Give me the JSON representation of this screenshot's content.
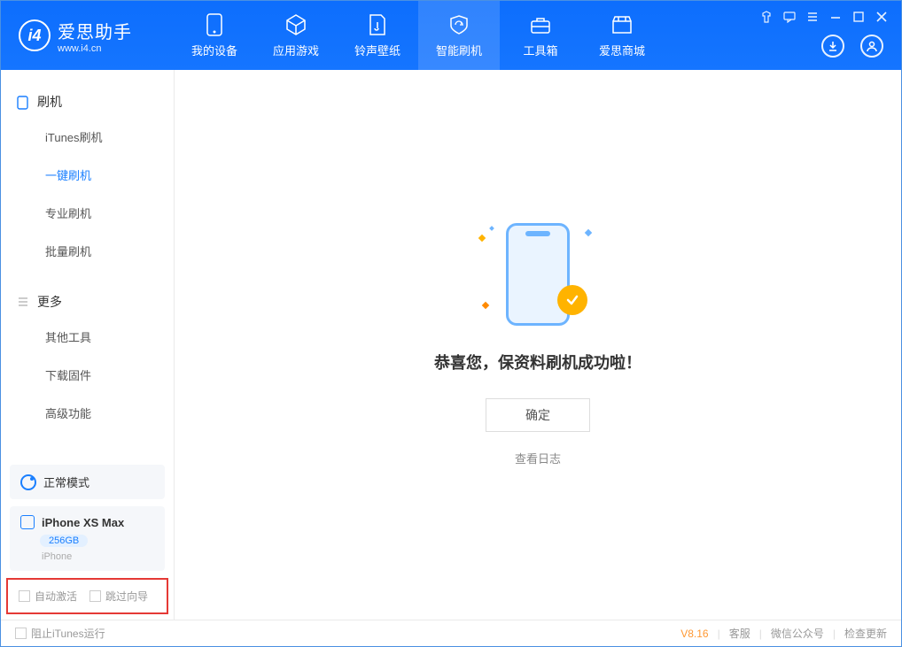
{
  "app": {
    "title": "爱思助手",
    "url": "www.i4.cn"
  },
  "nav": {
    "tabs": [
      {
        "label": "我的设备"
      },
      {
        "label": "应用游戏"
      },
      {
        "label": "铃声壁纸"
      },
      {
        "label": "智能刷机"
      },
      {
        "label": "工具箱"
      },
      {
        "label": "爱思商城"
      }
    ]
  },
  "sidebar": {
    "section1": {
      "title": "刷机",
      "items": [
        "iTunes刷机",
        "一键刷机",
        "专业刷机",
        "批量刷机"
      ]
    },
    "section2": {
      "title": "更多",
      "items": [
        "其他工具",
        "下载固件",
        "高级功能"
      ]
    }
  },
  "mode": {
    "label": "正常模式"
  },
  "device": {
    "name": "iPhone XS Max",
    "capacity": "256GB",
    "type": "iPhone"
  },
  "options": {
    "auto_activate": "自动激活",
    "skip_guide": "跳过向导"
  },
  "main": {
    "success_title": "恭喜您，保资料刷机成功啦！",
    "ok_button": "确定",
    "view_log": "查看日志"
  },
  "footer": {
    "stop_itunes": "阻止iTunes运行",
    "version": "V8.16",
    "links": [
      "客服",
      "微信公众号",
      "检查更新"
    ]
  }
}
